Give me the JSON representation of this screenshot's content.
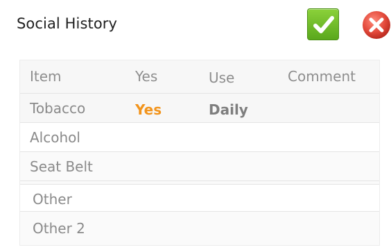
{
  "header": {
    "title": "Social History",
    "confirm_icon": "checkmark-icon",
    "cancel_icon": "close-icon",
    "confirm_color": "#6dbb24",
    "cancel_color": "#e2483a"
  },
  "table": {
    "columns": [
      "Item",
      "Yes",
      "Use",
      "Comment"
    ],
    "rows": [
      {
        "item": "Tobacco",
        "yes": "Yes",
        "use": "Daily",
        "comment": ""
      },
      {
        "item": "Alcohol",
        "yes": "",
        "use": "",
        "comment": ""
      },
      {
        "item": "Seat Belt",
        "yes": "",
        "use": "",
        "comment": ""
      },
      {
        "item": "Other",
        "yes": "",
        "use": "",
        "comment": ""
      },
      {
        "item": "Other 2",
        "yes": "",
        "use": "",
        "comment": ""
      }
    ],
    "accent_color": "#f2941c"
  }
}
